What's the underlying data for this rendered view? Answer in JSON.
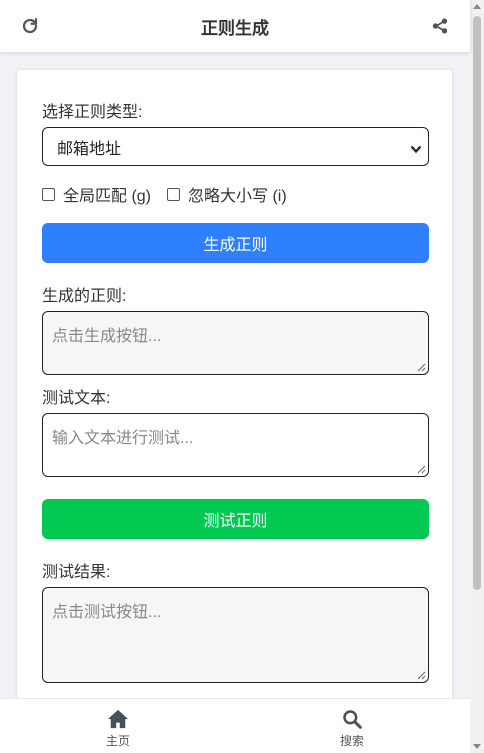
{
  "header": {
    "title": "正则生成",
    "refresh_icon": "refresh-icon",
    "share_icon": "share-icon"
  },
  "form": {
    "type_label": "选择正则类型:",
    "type_selected": "邮箱地址",
    "global_match_label": "全局匹配 (g)",
    "ignore_case_label": "忽略大小写 (i)",
    "global_match_checked": false,
    "ignore_case_checked": false,
    "generate_button": "生成正则",
    "generated_label": "生成的正则:",
    "generated_placeholder": "点击生成按钮...",
    "test_text_label": "测试文本:",
    "test_text_placeholder": "输入文本进行测试...",
    "test_button": "测试正则",
    "result_label": "测试结果:",
    "result_placeholder": "点击测试按钮..."
  },
  "nav": {
    "home_label": "主页",
    "search_label": "搜索"
  },
  "colors": {
    "accent_blue": "#2f80ff",
    "accent_green": "#00c851",
    "page_bg": "#f0f2f5"
  }
}
